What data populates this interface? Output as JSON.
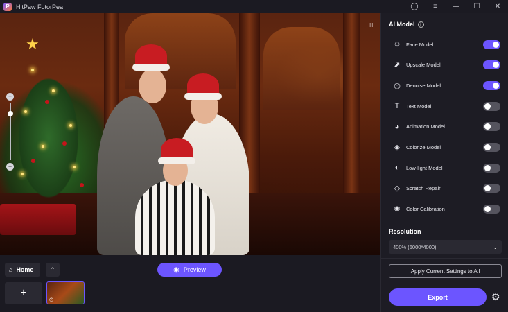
{
  "window": {
    "title": "HitPaw FotorPea",
    "logo_letter": "P",
    "controls": {
      "account": "◯",
      "menu": "≡",
      "minimize": "—",
      "maximize": "☐",
      "close": "✕"
    }
  },
  "canvas": {
    "crop_icon": "⌗",
    "zoom": {
      "plus": "+",
      "minus": "−",
      "level": 0.85
    }
  },
  "bottom_bar": {
    "home_label": "Home",
    "home_icon": "⌂",
    "collapse_icon": "⌃",
    "preview_label": "Preview",
    "preview_icon": "◉",
    "add_icon": "+",
    "thumbnail_icon": "◷"
  },
  "panel": {
    "title": "AI Model",
    "info_icon": "i",
    "models": [
      {
        "label": "Face Model",
        "icon": "☺",
        "icon_name": "face-icon",
        "on": true
      },
      {
        "label": "Upscale Model",
        "icon": "⬈",
        "icon_name": "upscale-icon",
        "on": true
      },
      {
        "label": "Denoise Model",
        "icon": "◎",
        "icon_name": "denoise-icon",
        "on": true
      },
      {
        "label": "Text Model",
        "icon": "T",
        "icon_name": "text-icon",
        "on": false
      },
      {
        "label": "Animation Model",
        "icon": "◕",
        "icon_name": "animation-icon",
        "on": false
      },
      {
        "label": "Colorize Model",
        "icon": "◈",
        "icon_name": "colorize-icon",
        "on": false
      },
      {
        "label": "Low-light Model",
        "icon": "◐",
        "icon_name": "low-light-icon",
        "on": false
      },
      {
        "label": "Scratch Repair",
        "icon": "◇",
        "icon_name": "scratch-repair-icon",
        "on": false
      },
      {
        "label": "Color Calibration",
        "icon": "✺",
        "icon_name": "color-calibration-icon",
        "on": false
      }
    ],
    "resolution_label": "Resolution",
    "resolution_value": "400% (6000*4000)",
    "resolution_chevron": "⌄",
    "apply_label": "Apply Current Settings to All",
    "export_label": "Export",
    "settings_icon": "⚙"
  },
  "colors": {
    "accent": "#6c55ff",
    "panel_bg": "#1d1c24",
    "app_bg": "#16151d"
  }
}
